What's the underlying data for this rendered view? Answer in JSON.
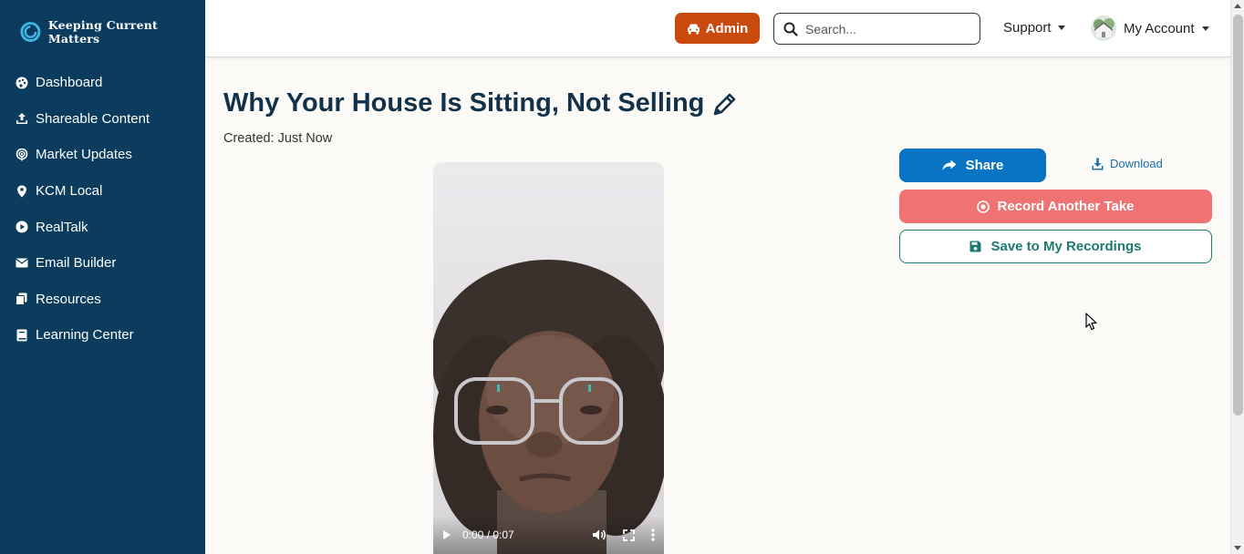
{
  "brand": {
    "name": "Keeping Current Matters"
  },
  "sidebar": {
    "items": [
      {
        "label": "Dashboard",
        "icon": "palette-icon"
      },
      {
        "label": "Shareable Content",
        "icon": "upload-icon"
      },
      {
        "label": "Market Updates",
        "icon": "podcast-icon"
      },
      {
        "label": "KCM Local",
        "icon": "map-pin-icon"
      },
      {
        "label": "RealTalk",
        "icon": "play-circle-icon"
      },
      {
        "label": "Email Builder",
        "icon": "envelope-icon"
      },
      {
        "label": "Resources",
        "icon": "copy-icon"
      },
      {
        "label": "Learning Center",
        "icon": "book-icon"
      }
    ]
  },
  "topbar": {
    "admin_label": "Admin",
    "search_placeholder": "Search...",
    "support_label": "Support",
    "account_label": "My Account"
  },
  "main": {
    "title": "Why Your House Is Sitting, Not Selling",
    "created": "Created: Just Now",
    "video": {
      "time": "0:00 / 0:07"
    }
  },
  "actions": {
    "share_label": "Share",
    "download_label": "Download",
    "record_label": "Record Another Take",
    "save_label": "Save to My Recordings"
  },
  "colors": {
    "sidebar": "#0b3c5d",
    "admin": "#c94a0c",
    "share": "#0a74c4",
    "record": "#f07374",
    "save_border": "#1d7a70"
  }
}
